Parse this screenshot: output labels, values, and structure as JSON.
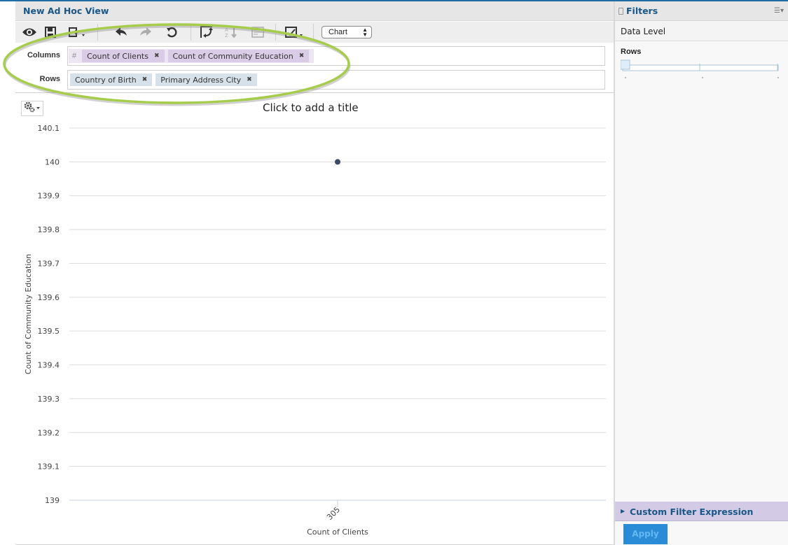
{
  "view": {
    "title": "New Ad Hoc View"
  },
  "toolbar": {
    "buttons": [
      {
        "icon": "eye-icon",
        "label": "Display Mode"
      },
      {
        "icon": "save-icon",
        "label": "Save"
      },
      {
        "icon": "export-icon",
        "label": "Export"
      },
      {
        "icon": "undo-icon",
        "label": "Undo"
      },
      {
        "icon": "redo-icon",
        "label": "Redo"
      },
      {
        "icon": "undo-all-icon",
        "label": "Undo All"
      },
      {
        "icon": "pivot-icon",
        "label": "Switch Group"
      },
      {
        "icon": "sort-icon",
        "label": "Sort"
      },
      {
        "icon": "sql-icon",
        "label": "Query"
      },
      {
        "icon": "chart-format-icon",
        "label": "Chart Format"
      }
    ],
    "view_type": "Chart"
  },
  "columns": {
    "label": "Columns",
    "measures_marker": "#",
    "items": [
      "Count of Clients",
      "Count of Community Education"
    ]
  },
  "rows": {
    "label": "Rows",
    "items": [
      "Country of Birth",
      "Primary Address City"
    ]
  },
  "chart_area": {
    "title_placeholder": "Click to add a title",
    "options_icon": "gear-icon"
  },
  "chart_data": {
    "type": "scatter",
    "title": "Click to add a title",
    "xlabel": "Count of Clients",
    "ylabel": "Count of Community Education",
    "x_tick_labels": [
      "305"
    ],
    "y_tick_labels": [
      "139",
      "139.1",
      "139.2",
      "139.3",
      "139.4",
      "139.5",
      "139.6",
      "139.7",
      "139.8",
      "139.9",
      "140",
      "140.1"
    ],
    "ylim": [
      139,
      140.1
    ],
    "grid": true,
    "points": [
      {
        "x": 305,
        "y": 140
      }
    ],
    "point_color": "#3d4a63"
  },
  "filters": {
    "title": "Filters",
    "data_level_label": "Data Level",
    "rows_label": "Rows",
    "slider": {
      "levels": 3,
      "selected_index": 0
    },
    "custom_filter_label": "Custom Filter Expression",
    "apply_label": "Apply"
  },
  "colors": {
    "brand_blue": "#1a5686",
    "highlight_green": "#a6cc4b",
    "measure_pill": "#d9cce6",
    "dimension_pill": "#d6e1ea",
    "apply_button": "#2a8bd6"
  }
}
